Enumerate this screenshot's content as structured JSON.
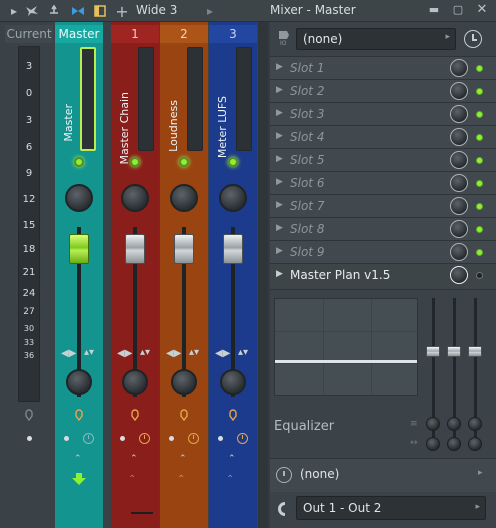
{
  "toolbar": {
    "layout_label": "Wide 3",
    "title": "Mixer - Master",
    "plus": "+"
  },
  "mixer": {
    "current_label": "Current",
    "scale": [
      "3",
      "0",
      "3",
      "6",
      "9",
      "12",
      "15",
      "18",
      "21",
      "24",
      "27",
      "30",
      "33",
      "36"
    ],
    "channels": [
      {
        "number": "Master",
        "name": "Master",
        "color": "#13948f"
      },
      {
        "number": "1",
        "name": "Master Chain",
        "color": "#8a1e1b"
      },
      {
        "number": "2",
        "name": "Loudness",
        "color": "#9a4412"
      },
      {
        "number": "3",
        "name": "Meter LUFS",
        "color": "#1c3b8c"
      }
    ]
  },
  "right_panel": {
    "input_select": "(none)",
    "slots": [
      "Slot 1",
      "Slot 2",
      "Slot 3",
      "Slot 4",
      "Slot 5",
      "Slot 6",
      "Slot 7",
      "Slot 8",
      "Slot 9"
    ],
    "master_slot": "Master Plan v1.5",
    "eq_label": "Equalizer",
    "output_select": "(none)",
    "output_route": "Out 1 - Out 2"
  }
}
